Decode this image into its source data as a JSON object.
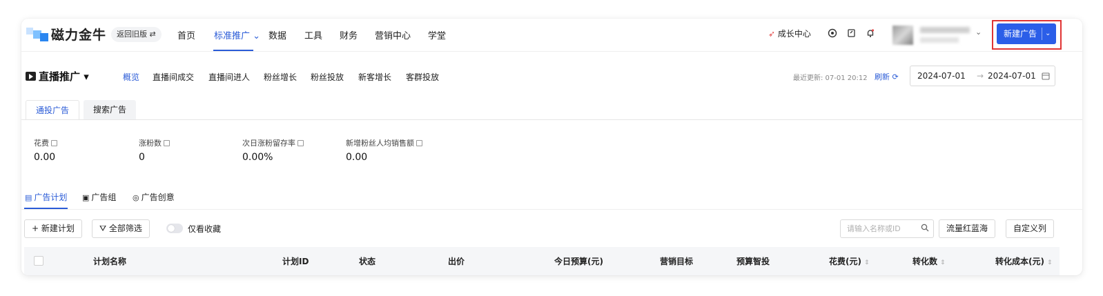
{
  "header": {
    "brand": "磁力金牛",
    "old_version": "返回旧版 ⇄",
    "nav": [
      {
        "label": "首页"
      },
      {
        "label": "标准推广 ⌄",
        "active": true
      },
      {
        "label": "数据"
      },
      {
        "label": "工具"
      },
      {
        "label": "财务"
      },
      {
        "label": "营销中心"
      },
      {
        "label": "学堂"
      }
    ],
    "growth_center": "成长中心",
    "new_ad_label": "新建广告",
    "new_ad_chevron": "⌄",
    "user_chevron": "⌄"
  },
  "subheader": {
    "title": "直播推广 ▾",
    "tabs": [
      "概览",
      "直播间成交",
      "直播间进人",
      "粉丝增长",
      "粉丝投放",
      "新客增长",
      "客群投放"
    ],
    "last_updated": "最近更新: 07-01 20:12",
    "refresh": "刷新 ⟳",
    "date_start": "2024-07-01",
    "date_arrow": "→",
    "date_end": "2024-07-01"
  },
  "ad_type_tabs": [
    "通投广告",
    "搜索广告"
  ],
  "metrics": [
    {
      "label": "花费",
      "value": "0.00"
    },
    {
      "label": "涨粉数",
      "value": "0"
    },
    {
      "label": "次日涨粉留存率",
      "value": "0.00%"
    },
    {
      "label": "新增粉丝人均销售额",
      "value": "0.00"
    }
  ],
  "entity_tabs": [
    "广告计划",
    "广告组",
    "广告创意"
  ],
  "toolbar": {
    "new_plan": "+ 新建计划",
    "filter_all": "全部筛选",
    "favorites_only": "仅看收藏",
    "search_placeholder": "请输入名称或ID",
    "traffic_analysis": "流量红蓝海",
    "custom_columns": "自定义列"
  },
  "table": {
    "columns": [
      "计划名称",
      "计划ID",
      "状态",
      "出价",
      "今日预算(元)",
      "营销目标",
      "预算智投",
      "花费(元)",
      "转化数",
      "转化成本(元)"
    ]
  },
  "colors": {
    "accent": "#2a5bd7",
    "primary_button": "#2b5ee8",
    "highlight_border": "#e03333"
  }
}
